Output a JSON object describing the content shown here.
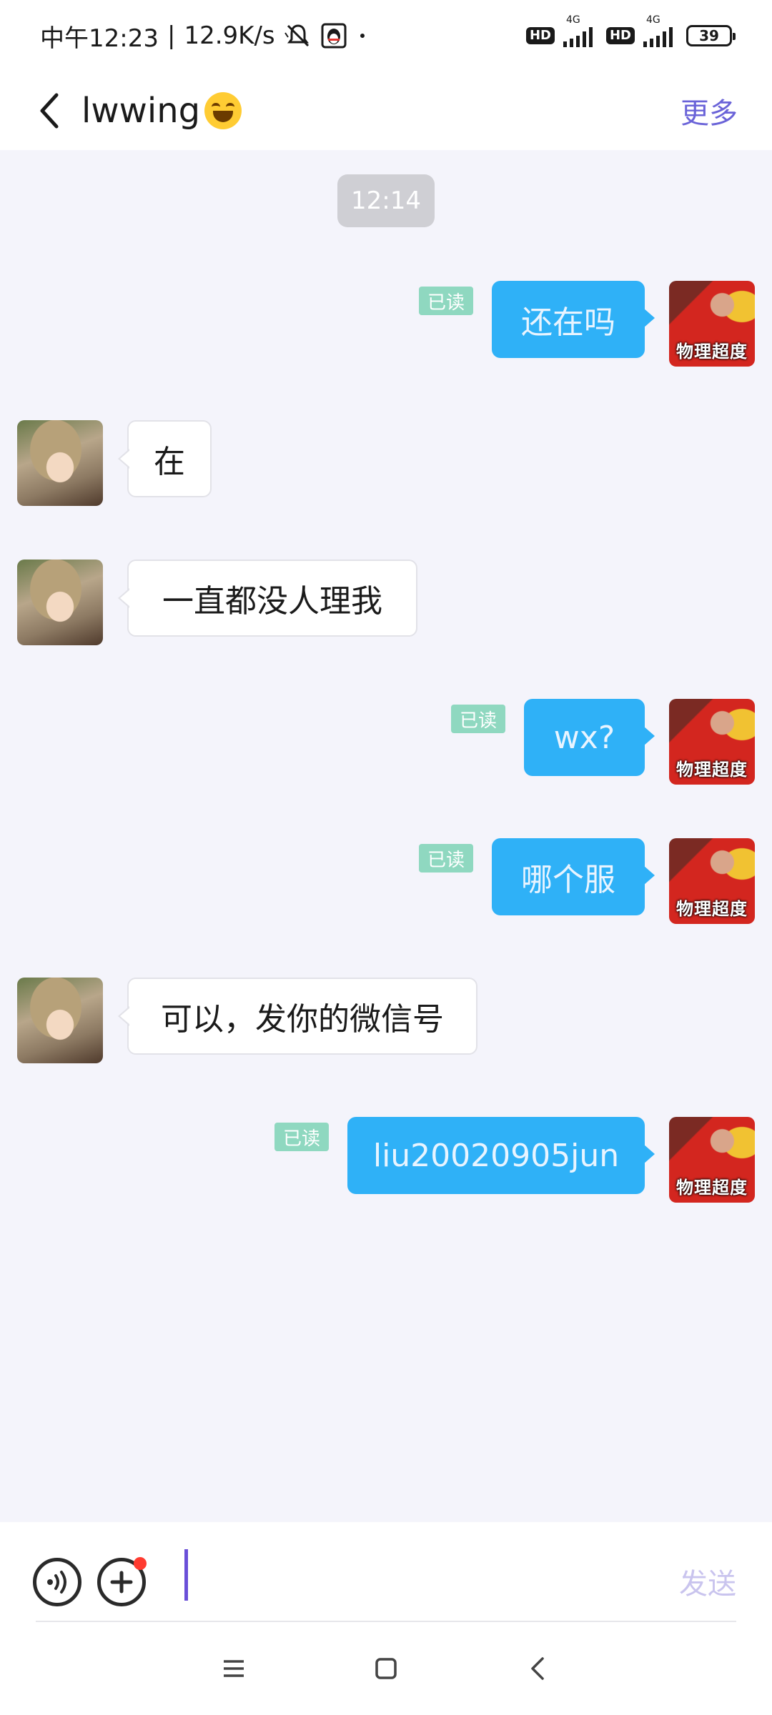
{
  "status_bar": {
    "time": "中午12:23",
    "separator": "|",
    "speed": "12.9K/s",
    "hd1": "HD",
    "net1": "4G",
    "hd2": "HD",
    "net2": "4G",
    "battery": "39"
  },
  "header": {
    "title": "lwwing",
    "emoji": "grinning-face-emoji",
    "more_label": "更多"
  },
  "chat": {
    "time_divider": "12:14",
    "read_label": "已读",
    "self_avatar_stamp": "物理超度",
    "messages": [
      {
        "from": "self",
        "text": "还在吗",
        "read": true
      },
      {
        "from": "other",
        "text": "在"
      },
      {
        "from": "other",
        "text": "一直都没人理我"
      },
      {
        "from": "self",
        "text": "wx?",
        "read": true
      },
      {
        "from": "self",
        "text": "哪个服",
        "read": true
      },
      {
        "from": "other",
        "text": "可以，发你的微信号"
      },
      {
        "from": "self",
        "text": "liu20020905jun",
        "read": true
      }
    ]
  },
  "input_bar": {
    "send_label": "发送",
    "voice_icon": "voice-icon",
    "plus_icon": "plus-icon"
  },
  "nav": {
    "menu_icon": "menu-icon",
    "home_icon": "home-icon",
    "back_icon": "back-icon"
  },
  "colors": {
    "self_bubble": "#2fb1f7",
    "accent": "#6a63d8",
    "read_tag": "#8fd8c0",
    "chat_bg": "#f4f4fb"
  }
}
